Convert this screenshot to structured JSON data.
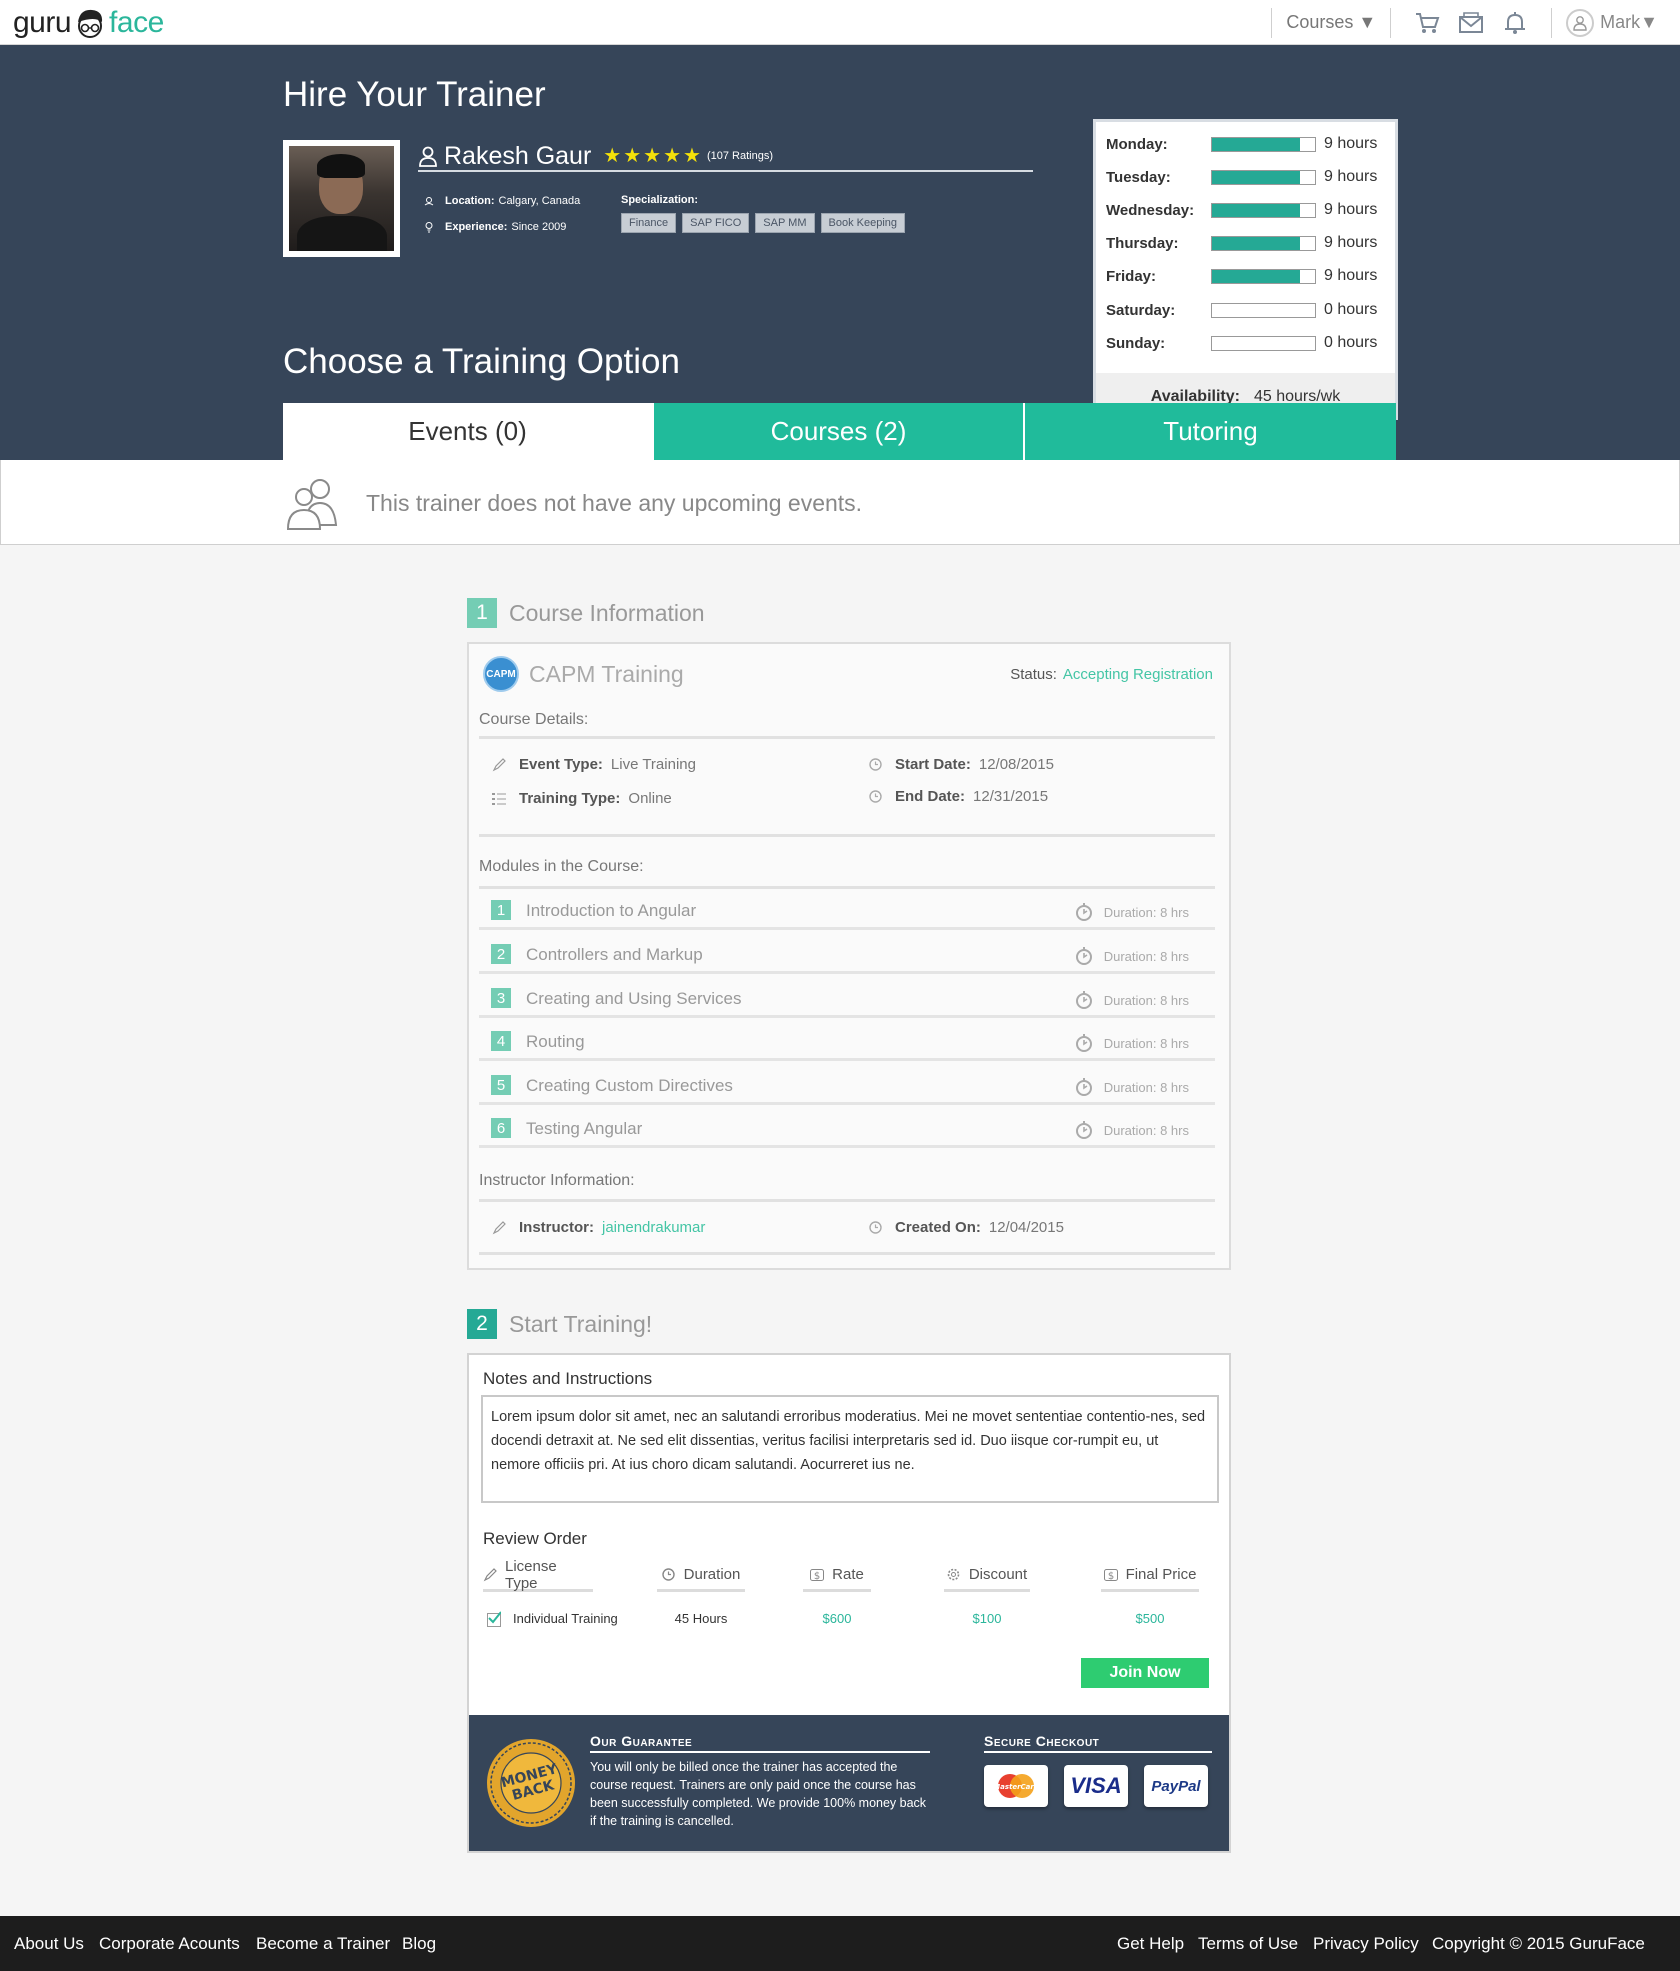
{
  "nav": {
    "logo_left": "guru",
    "logo_right": "face",
    "courses": "Courses ▼",
    "user": "Mark▼"
  },
  "hero": {
    "title": "Hire Your Trainer",
    "trainer_name": "Rakesh Gaur",
    "rating_stars": 5,
    "ratings": "(107 Ratings)",
    "location_label": "Location:",
    "location_value": "Calgary, Canada",
    "experience_label": "Experience:",
    "experience_value": "Since 2009",
    "specialization_label": "Specialization:",
    "specializations": [
      "Finance",
      "SAP FICO",
      "SAP MM",
      "Book Keeping"
    ],
    "section_title": "Choose a Training Option"
  },
  "availability": {
    "days": [
      {
        "day": "Monday:",
        "hours": "9 hours",
        "fill": 0.85
      },
      {
        "day": "Tuesday:",
        "hours": "9 hours",
        "fill": 0.85
      },
      {
        "day": "Wednesday:",
        "hours": "9 hours",
        "fill": 0.85
      },
      {
        "day": "Thursday:",
        "hours": "9 hours",
        "fill": 0.85
      },
      {
        "day": "Friday:",
        "hours": "9 hours",
        "fill": 0.85
      },
      {
        "day": "Saturday:",
        "hours": "0 hours",
        "fill": 0
      },
      {
        "day": "Sunday:",
        "hours": "0 hours",
        "fill": 0
      }
    ],
    "total_label": "Availability:",
    "total_value": "45 hours/wk"
  },
  "tabs": [
    {
      "label": "Events (0)",
      "active": true
    },
    {
      "label": "Courses (2)",
      "active": false
    },
    {
      "label": "Tutoring",
      "active": false
    }
  ],
  "events": {
    "empty_message": "This trainer does not have any upcoming events."
  },
  "step1": {
    "number": "1",
    "title": "Course Information",
    "course_logo": "CAPM",
    "course_name": "CAPM Training",
    "status_label": "Status:",
    "status_value": "Accepting Registration",
    "details_heading": "Course Details:",
    "event_type_label": "Event Type:",
    "event_type_value": "Live Training",
    "training_type_label": "Training Type:",
    "training_type_value": "Online",
    "start_date_label": "Start Date:",
    "start_date_value": "12/08/2015",
    "end_date_label": "End Date:",
    "end_date_value": "12/31/2015",
    "modules_heading": "Modules in the Course:",
    "modules": [
      {
        "num": "1",
        "title": "Introduction to Angular",
        "duration": "Duration: 8 hrs"
      },
      {
        "num": "2",
        "title": "Controllers and Markup",
        "duration": "Duration: 8 hrs"
      },
      {
        "num": "3",
        "title": "Creating and Using Services",
        "duration": "Duration: 8 hrs"
      },
      {
        "num": "4",
        "title": "Routing",
        "duration": "Duration: 8 hrs"
      },
      {
        "num": "5",
        "title": "Creating Custom Directives",
        "duration": "Duration: 8 hrs"
      },
      {
        "num": "6",
        "title": "Testing Angular",
        "duration": "Duration: 8 hrs"
      }
    ],
    "instructor_heading": "Instructor Information:",
    "instructor_label": "Instructor:",
    "instructor_value": "jainendrakumar",
    "created_label": "Created On:",
    "created_value": "12/04/2015"
  },
  "step2": {
    "number": "2",
    "title": "Start Training!",
    "notes_title": "Notes and Instructions",
    "notes_text": "Lorem ipsum dolor sit amet, nec an salutandi erroribus moderatius. Mei ne movet sententiae contentio-nes, sed docendi detraxit at. Ne sed elit dissentias, veritus facilisi interpretaris sed id. Duo iisque cor-rumpit eu, ut nemore officiis pri. At ius choro dicam salutandi. Aocurreret ius ne.",
    "review_title": "Review Order",
    "columns": [
      "License Type",
      "Duration",
      "Rate",
      "Discount",
      "Final Price"
    ],
    "row": {
      "license": "Individual Training",
      "duration": "45 Hours",
      "rate": "$600",
      "discount": "$100",
      "final": "$500",
      "checked": true
    },
    "join_button": "Join Now",
    "guarantee_title": "Our Guarantee",
    "guarantee_text": "You will only be billed once the trainer has accepted the course request. Trainers are only paid once the course has been successfully completed. We provide 100% money back if the training is cancelled.",
    "seal_text": "MONEY BACK",
    "secure_title": "Secure Checkout",
    "payments": [
      "MasterCard",
      "VISA",
      "PayPal"
    ]
  },
  "footer": {
    "left_links": [
      "About Us",
      "Corporate Acounts",
      "Become a Trainer",
      "Blog"
    ],
    "right_links": [
      "Get Help",
      "Terms of Use",
      "Privacy Policy",
      "Copyright © 2015 GuruFace"
    ]
  },
  "colors": {
    "navy": "#364559",
    "teal": "#20bb9b",
    "green": "#2ecc71",
    "star": "#f5e10a"
  }
}
